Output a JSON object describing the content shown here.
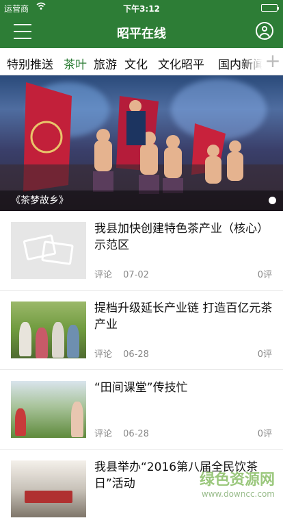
{
  "status_bar": {
    "carrier": "运营商",
    "time": "下午3:12"
  },
  "nav": {
    "title": "昭平在线"
  },
  "tabs": [
    {
      "label": "特别推送",
      "active": false
    },
    {
      "label": "茶叶",
      "active": true
    },
    {
      "label": "旅游",
      "active": false
    },
    {
      "label": "文化",
      "active": false
    },
    {
      "label": "文化昭平",
      "active": false
    },
    {
      "label": "国内新闻",
      "active": false
    }
  ],
  "tabs_add": "+",
  "banner": {
    "caption": "《茶梦故乡》"
  },
  "news": [
    {
      "title": "我县加快创建特色茶产业（核心）示范区",
      "comment_label": "评论",
      "date": "07-02",
      "count": "0评"
    },
    {
      "title": "提档升级延长产业链 打造百亿元茶产业",
      "comment_label": "评论",
      "date": "06-28",
      "count": "0评"
    },
    {
      "title": "“田间课堂”传技忙",
      "comment_label": "评论",
      "date": "06-28",
      "count": "0评"
    },
    {
      "title": "我县举办“2016第八届全民饮茶日”活动",
      "comment_label": "",
      "date": "",
      "count": ""
    }
  ],
  "watermark": {
    "main": "绿色资源网",
    "url": "www.downcc.com"
  },
  "colors": {
    "brand_green": "#2d7d36"
  }
}
